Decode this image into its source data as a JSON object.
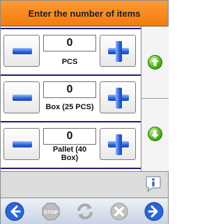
{
  "header": {
    "title": "Enter the number of items"
  },
  "rows": [
    {
      "value": "0",
      "unit": "PCS"
    },
    {
      "value": "0",
      "unit": "Box (25 PCS)"
    },
    {
      "value": "0",
      "unit": "Pallet (40 Box)"
    }
  ],
  "side": {
    "up": "arrow-up-icon",
    "down": "arrow-down-icon"
  },
  "footer": {
    "back": "back-arrow-icon",
    "stop": "STOP",
    "refresh": "refresh-icon",
    "cancel": "cancel-icon",
    "forward": "forward-arrow-icon"
  },
  "colors": {
    "header": "#f27c10",
    "accent": "#2b5fd8",
    "green": "#4fb71b",
    "rowline": "#1c1d7a"
  }
}
